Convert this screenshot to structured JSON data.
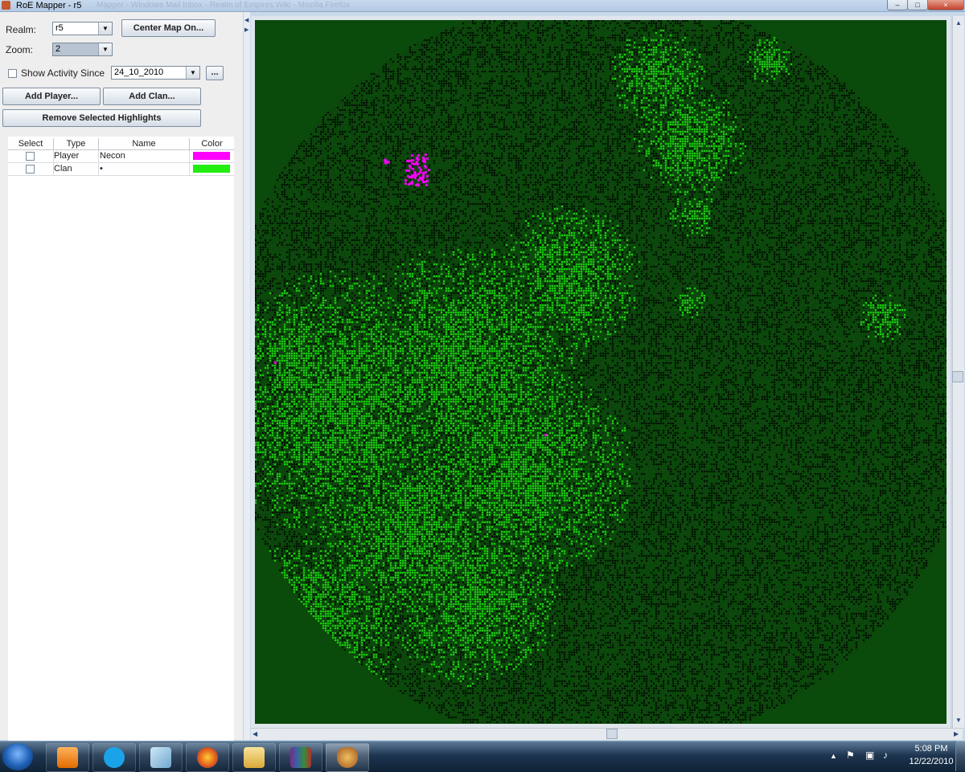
{
  "window": {
    "title": "RoE Mapper - r5",
    "background_title": "Mapper - Windows Mail Inbox - Realm of Empires Wiki - Mozilla Firefox",
    "controls": [
      "–",
      "□",
      "×"
    ]
  },
  "left_panel": {
    "realm_label": "Realm:",
    "realm_value": "r5",
    "center_map_button": "Center Map On...",
    "zoom_label": "Zoom:",
    "zoom_value": "2",
    "show_activity_label": "Show Activity Since",
    "show_activity_checked": false,
    "activity_date": "24_10_2010",
    "browse_button": "...",
    "add_player_button": "Add Player...",
    "add_clan_button": "Add Clan...",
    "remove_highlights_button": "Remove Selected Highlights",
    "table": {
      "columns": [
        "Select",
        "Type",
        "Name",
        "Color"
      ],
      "rows": [
        {
          "selected": false,
          "type": "Player",
          "name": "Necon",
          "color": "#ff00ff"
        },
        {
          "selected": false,
          "type": "Clan",
          "name": "•",
          "color": "#22ee11"
        }
      ]
    }
  },
  "map": {
    "background_color": "#0a4a0a",
    "territory_color": "#123f12",
    "clan_color": "#22ee11",
    "player_color": "#ff00ff"
  },
  "taskbar": {
    "time": "5:08 PM",
    "date": "12/22/2010",
    "items": [
      "windows-media-player",
      "skype",
      "notepad",
      "firefox",
      "explorer",
      "winrar",
      "roe-mapper"
    ]
  }
}
